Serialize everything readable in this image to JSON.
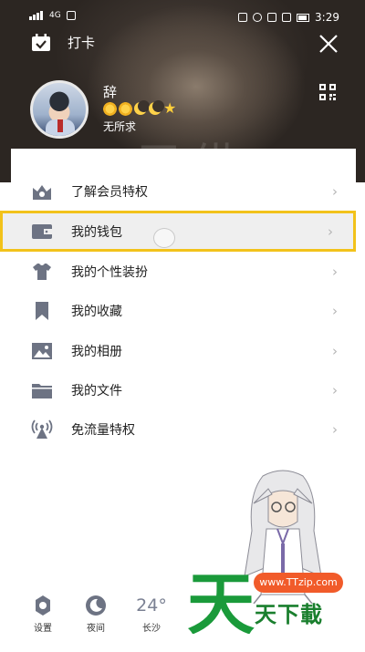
{
  "status_bar": {
    "time": "3:29",
    "signal_label": "4G"
  },
  "header": {
    "checkin_label": "打卡",
    "nickname": "辞",
    "signature": "无所求",
    "background_text": "天纵"
  },
  "menu": {
    "items": [
      {
        "label": "了解会员特权",
        "icon": "crown-icon"
      },
      {
        "label": "我的钱包",
        "icon": "wallet-icon"
      },
      {
        "label": "我的个性装扮",
        "icon": "shirt-icon"
      },
      {
        "label": "我的收藏",
        "icon": "bookmark-icon"
      },
      {
        "label": "我的相册",
        "icon": "photo-icon"
      },
      {
        "label": "我的文件",
        "icon": "folder-icon"
      },
      {
        "label": "免流量特权",
        "icon": "broadcast-icon"
      }
    ],
    "chevron": "›"
  },
  "bottom_bar": {
    "settings_label": "设置",
    "night_label": "夜间",
    "temperature": "24°",
    "city": "长沙"
  },
  "watermark": {
    "url": "www.TTzip.com",
    "text": "天下載",
    "logo_char": "天"
  },
  "colors": {
    "highlight_border": "#f2c21b",
    "icon_gray": "#6d7383",
    "watermark_green": "#1a7f2e",
    "watermark_orange": "#f15b2a"
  }
}
